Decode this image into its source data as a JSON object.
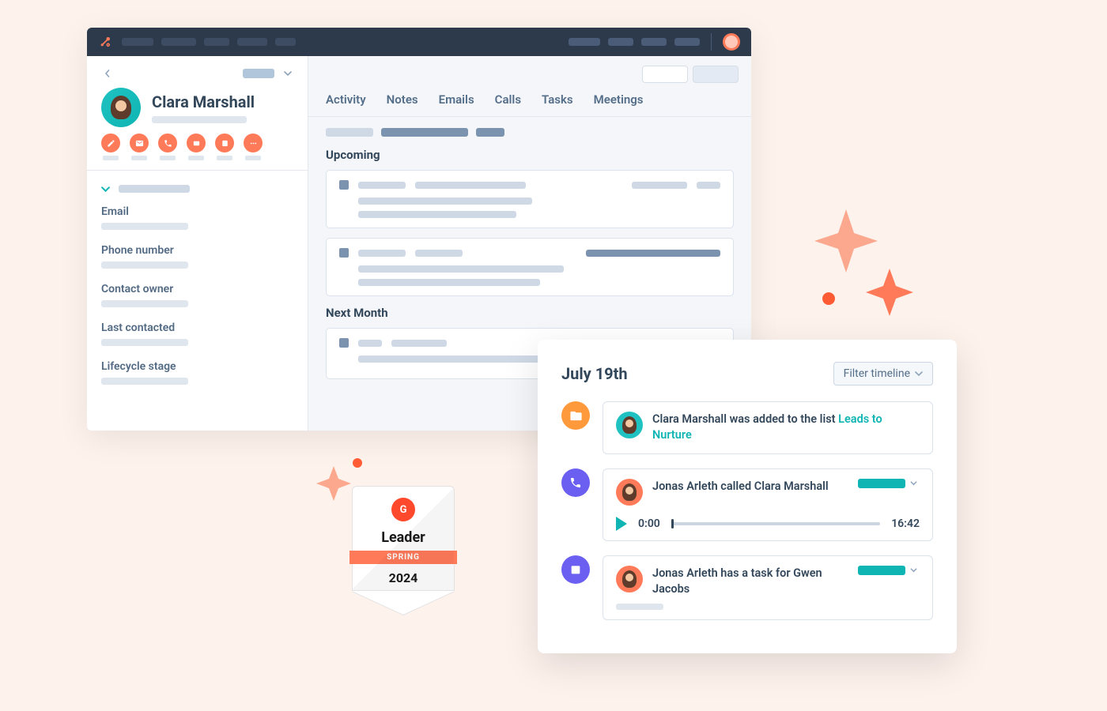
{
  "contact": {
    "name": "Clara Marshall"
  },
  "sidebar_fields": {
    "email": "Email",
    "phone": "Phone number",
    "owner": "Contact owner",
    "last_contacted": "Last contacted",
    "lifecycle": "Lifecycle stage"
  },
  "tabs": {
    "activity": "Activity",
    "notes": "Notes",
    "emails": "Emails",
    "calls": "Calls",
    "tasks": "Tasks",
    "meetings": "Meetings"
  },
  "sections": {
    "upcoming": "Upcoming",
    "next_month": "Next Month"
  },
  "timeline": {
    "date": "July 19th",
    "filter_label": "Filter timeline",
    "item1_prefix": "Clara Marshall was added to the list ",
    "item1_link": "Leads to Nurture",
    "item2": "Jonas Arleth called Clara Marshall",
    "player_start": "0:00",
    "player_end": "16:42",
    "item3": "Jonas Arleth has a task for Gwen Jacobs"
  },
  "badge": {
    "g2": "G",
    "title": "Leader",
    "season": "SPRING",
    "year": "2024"
  }
}
